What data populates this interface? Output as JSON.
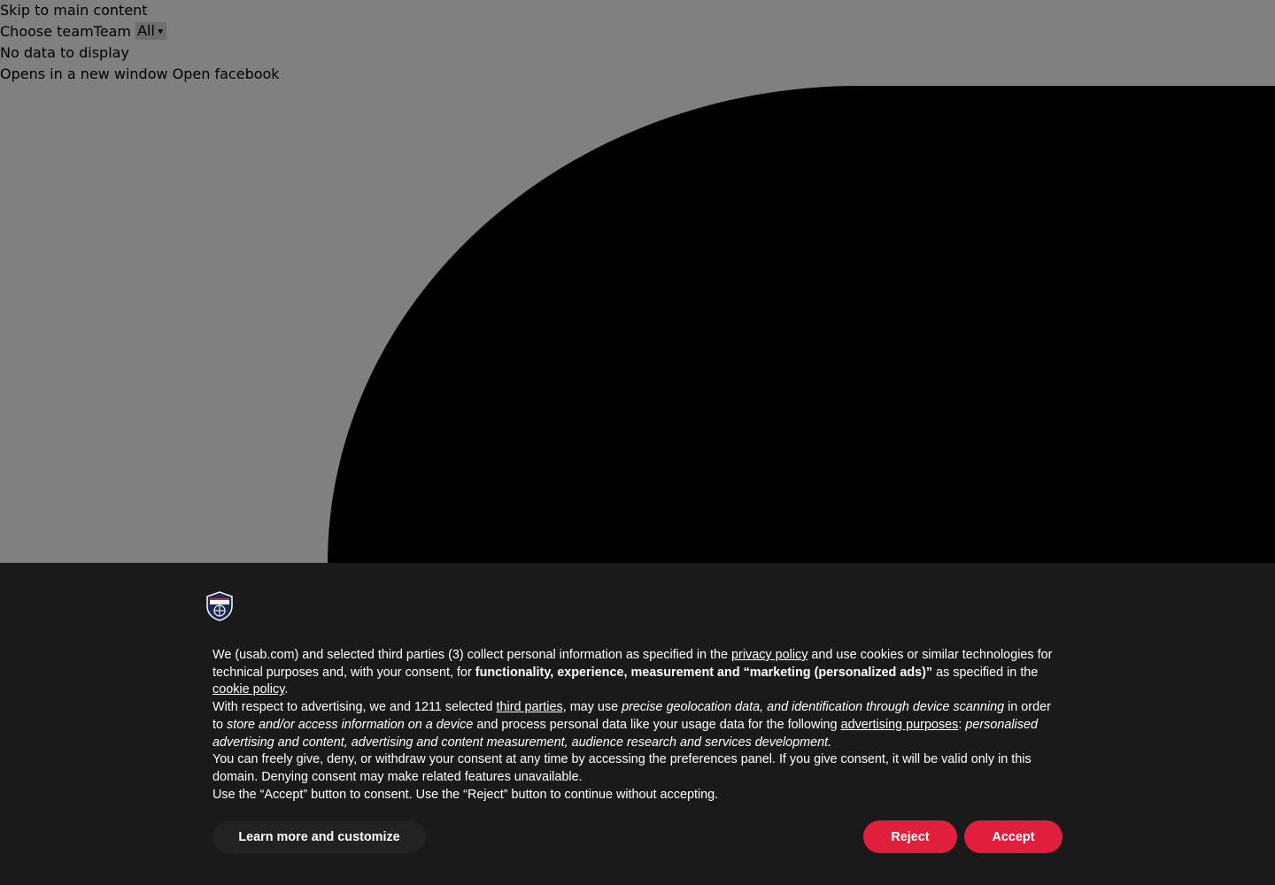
{
  "top": {
    "skip_link": "Skip to main content",
    "choose_team_label": "Choose team",
    "team_label": "Team",
    "team_select_value": "All",
    "no_data": "No data to display",
    "opens_new_window": "Opens in a new window",
    "open_facebook": "Open facebook"
  },
  "banner": {
    "logo_text": "USA",
    "p1": {
      "t1": "We (usab.com) and selected third parties (3) collect personal information as specified in the ",
      "link_privacy": "privacy policy",
      "t2": " and use cookies or similar technologies for technical purposes and, with your consent, for ",
      "bold": "functionality, experience, measurement and “marketing (personalized ads)”",
      "t3": " as specified in the ",
      "link_cookie": "cookie policy",
      "t4": "."
    },
    "p2": {
      "t1": "With respect to advertising, we and 1211 selected ",
      "link_third_parties": "third parties",
      "t2": ", may use ",
      "italic1": "precise geolocation data, and identification through device scanning",
      "t3": " in order to ",
      "italic2": "store and/or access information on a device",
      "t4": " and process personal data like your usage data for the following ",
      "link_ad_purposes": "advertising purposes",
      "t5": ": ",
      "italic3": "personalised advertising and content, advertising and content measurement, audience research and services development."
    },
    "p3": "You can freely give, deny, or withdraw your consent at any time by accessing the preferences panel. If you give consent, it will be valid only in this domain. Denying consent may make related features unavailable.",
    "p4": "Use the “Accept” button to consent. Use the “Reject” button to continue without accepting.",
    "buttons": {
      "customize": "Learn more and customize",
      "reject": "Reject",
      "accept": "Accept"
    },
    "colors": {
      "background": "#1a1a1a",
      "accent": "#e01f3d"
    }
  }
}
